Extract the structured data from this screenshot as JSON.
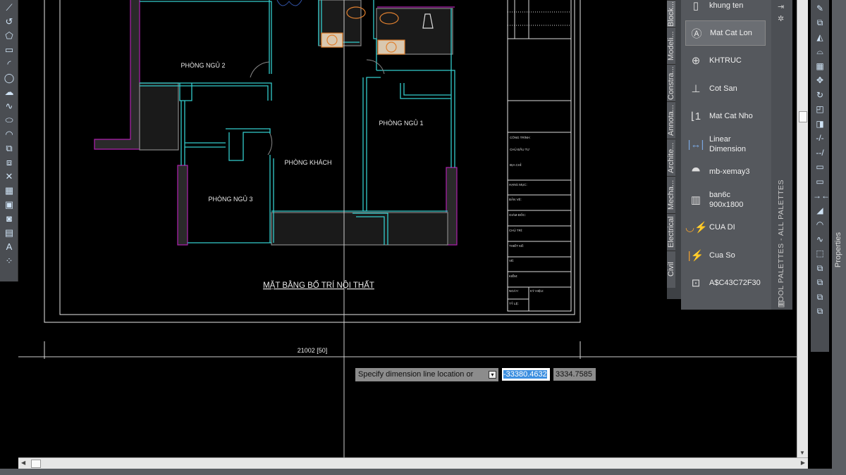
{
  "drawing": {
    "rooms": [
      "PHÒNG NGỦ 2",
      "PHÒNG NGỦ 1",
      "PHÒNG KHÁCH",
      "PHÒNG NGỦ 3"
    ],
    "title": "MẶT BẰNG BỐ TRÍ NỘI THẤT",
    "dimension_text": "21002 [50]",
    "title_block": [
      "CÔNG TRÌNH:",
      "CHỦ ĐẦU TƯ",
      "ĐỊA CHỈ:",
      "HẠNG MỤC:",
      "BẢN VẼ:",
      "GIÁM ĐỐC:",
      "CHỦ TRÌ:",
      "THIẾT KẾ:",
      "VẼ:",
      "KIỂM:",
      "NGÀY:",
      "KÝ HIỆU:",
      "TỶ LỆ:"
    ],
    "colors": {
      "walls": "#33cccc",
      "hatch_walls": "#b020b0",
      "fixtures": "#e08030",
      "frame": "#e8e8e8"
    }
  },
  "command": {
    "prompt": "Specify dimension line location or",
    "x_value": "-33380.4632",
    "y_value": "3334.7585"
  },
  "tool_palette": {
    "title": "TOOL PALETTES - ALL PALETTES",
    "tabs": [
      "Block...",
      "Modeli...",
      "Constra...",
      "Annota...",
      "Archite...",
      "Mecha...",
      "Electrical",
      "Civil"
    ],
    "items": [
      {
        "label": "khung ten",
        "icon": "frame-icon"
      },
      {
        "label": "Mat Cat Lon",
        "icon": "section-mark-icon",
        "selected": true
      },
      {
        "label": "KHTRUC",
        "icon": "axis-icon"
      },
      {
        "label": "Cot San",
        "icon": "level-icon"
      },
      {
        "label": "Mat Cat Nho",
        "icon": "section-small-icon"
      },
      {
        "label": "Linear Dimension",
        "icon": "linear-dimension-icon"
      },
      {
        "label": "mb-xemay3",
        "icon": "motorbike-icon"
      },
      {
        "label": "ban6c 900x1800",
        "icon": "table-icon"
      },
      {
        "label": "CUA DI",
        "icon": "door-icon"
      },
      {
        "label": "Cua So",
        "icon": "window-icon"
      },
      {
        "label": "A$C43C72F30",
        "icon": "block-icon"
      }
    ]
  },
  "properties_label": "Properties"
}
